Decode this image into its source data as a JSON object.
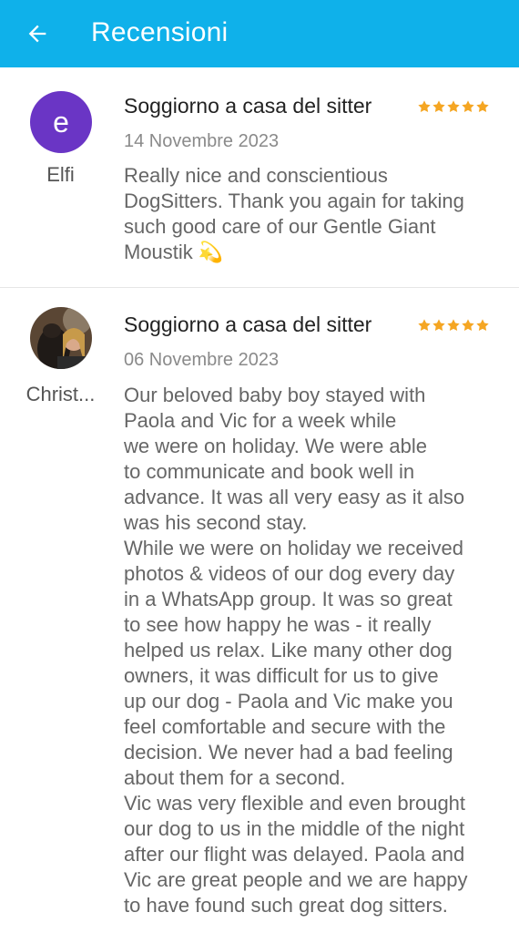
{
  "header": {
    "title": "Recensioni",
    "back_icon": "arrow-left-icon",
    "background": "#0fb1ea"
  },
  "reviews": [
    {
      "avatar_letter": "e",
      "avatar_color": "#6a35c5",
      "author": "Elfi",
      "service": "Soggiorno a casa del sitter",
      "rating": 5,
      "date": "14 Novembre 2023",
      "text": "Really nice and conscientious\nDogSitters. Thank you again for taking\nsuch good care of our Gentle Giant\nMoustik 💫"
    },
    {
      "avatar_letter": "",
      "author": "Christ...",
      "service": "Soggiorno a casa del sitter",
      "rating": 5,
      "date": "06 Novembre 2023",
      "text": "Our beloved baby boy stayed with\nPaola and Vic for a week while\nwe were on holiday. We were able\nto communicate and book well in\nadvance. It was all very easy as it also\nwas his second stay.\nWhile we were on holiday we received\nphotos & videos of our dog every day\nin a WhatsApp group. It was so great\nto see how happy he was - it really\nhelped us relax. Like many other dog\nowners, it was difficult for us to give\nup our dog - Paola and Vic make you\nfeel comfortable and secure with the\ndecision. We never had a bad feeling\nabout them for a second.\nVic was very flexible and even brought\nour dog to us in the middle of the night\nafter our flight was delayed. Paola and\nVic are great people and we are happy\nto have found such great dog sitters."
    }
  ],
  "colors": {
    "star": "#f5a623"
  }
}
